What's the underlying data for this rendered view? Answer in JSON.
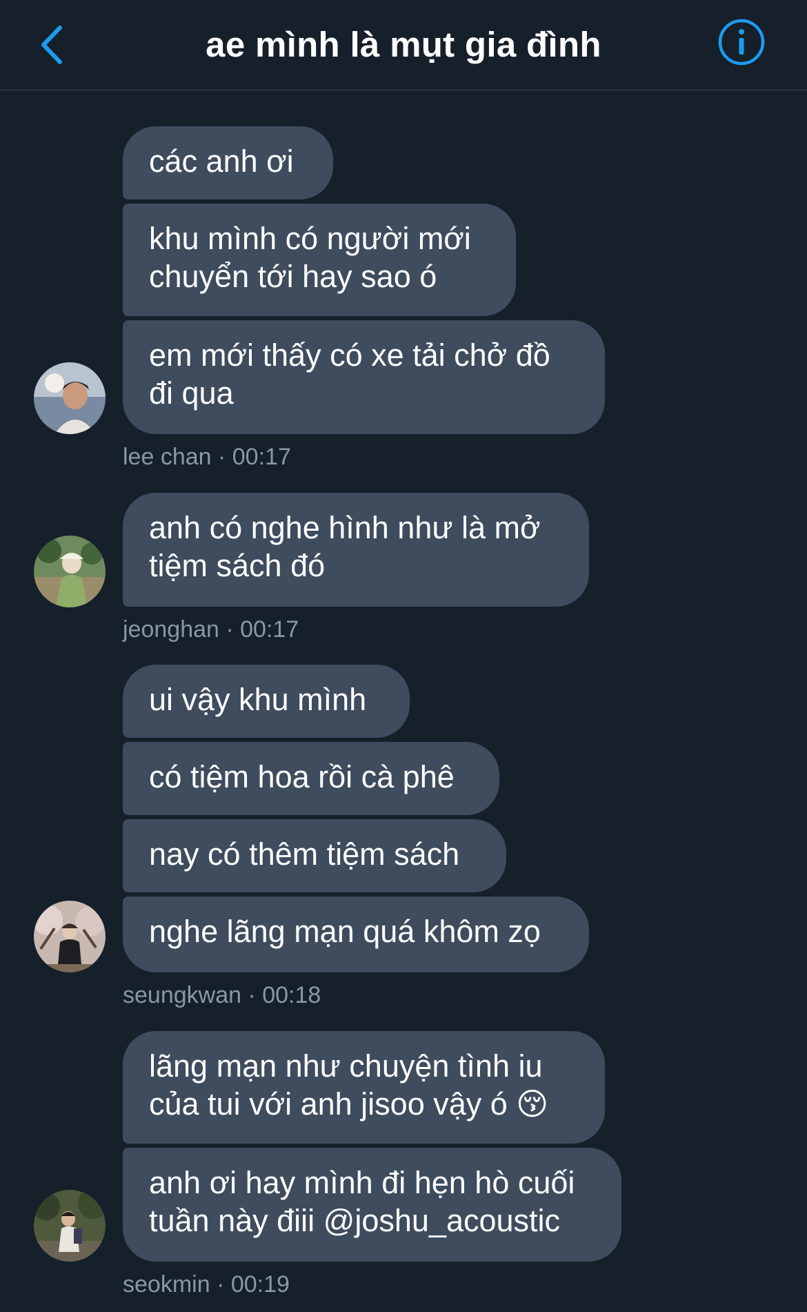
{
  "header": {
    "title": "ae mình là mụt gia đình"
  },
  "colors": {
    "background": "#15202b",
    "bubble": "#3e4c5d",
    "accent": "#1d9bf0",
    "meta_text": "#8899a6",
    "divider": "#38444d"
  },
  "icons": {
    "back": "chevron-left-icon",
    "info": "info-circle-icon"
  },
  "messages": [
    {
      "sender": "lee chan",
      "time": "00:17",
      "bubbles": [
        "các anh ơi",
        "khu mình có người mới\nchuyển tới hay sao ó",
        "em mới thấy có xe tải chở đồ\nđi qua"
      ]
    },
    {
      "sender": "jeonghan",
      "time": "00:17",
      "bubbles": [
        "anh có nghe hình như là mở\ntiệm sách đó"
      ]
    },
    {
      "sender": "seungkwan",
      "time": "00:18",
      "bubbles": [
        "ui vậy khu mình",
        "có tiệm hoa rồi cà phê",
        "nay có thêm tiệm sách",
        "nghe lãng mạn quá khôm zọ"
      ]
    },
    {
      "sender": "seokmin",
      "time": "00:19",
      "bubbles": [
        "lãng mạn như chuyện tình iu\ncủa tui với anh jisoo vậy ó 😚",
        "anh ơi hay mình đi hẹn hò cuối\ntuần này điii @joshu_acoustic"
      ]
    }
  ],
  "meta_separator": " · "
}
